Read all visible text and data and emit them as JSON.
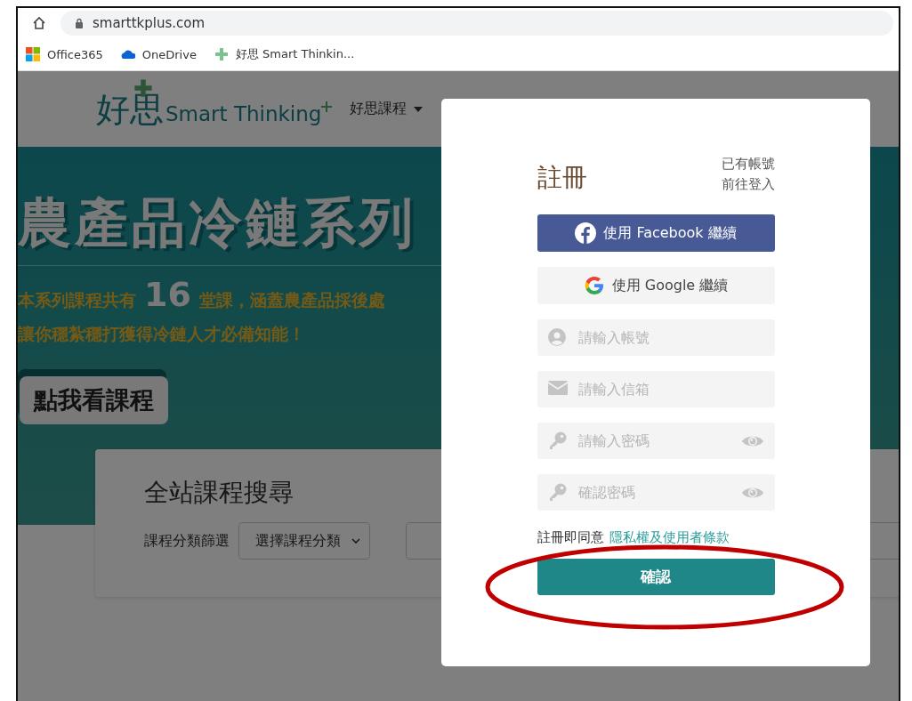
{
  "browser": {
    "url": "smarttkplus.com",
    "bookmarks": [
      {
        "kind": "office",
        "label": "Office365"
      },
      {
        "kind": "cloud",
        "label": "OneDrive"
      },
      {
        "kind": "plus",
        "label": "好思 Smart Thinkin..."
      }
    ]
  },
  "header": {
    "logo_cjk": "好思",
    "logo_text": "Smart Thinking",
    "nav": [
      {
        "label": "好思課程",
        "has_menu": true
      }
    ]
  },
  "banner": {
    "title": "農產品冷鏈系列",
    "line1_before": "本系列課程共有",
    "line1_number": "16",
    "line1_after": "堂課，涵蓋農產品採後處",
    "line2": "讓你穩紮穩打獲得冷鏈人才必備知能！",
    "button": "點我看課程"
  },
  "search": {
    "title": "全站課程搜尋",
    "filter_label": "課程分類篩選",
    "select": "選擇課程分類"
  },
  "modal": {
    "title": "註冊",
    "login_lines": [
      "已有帳號",
      "前往登入"
    ],
    "social": [
      {
        "kind": "facebook",
        "label": "使用 Facebook 繼續"
      },
      {
        "kind": "google",
        "label": "使用 Google 繼續"
      }
    ],
    "fields": [
      {
        "kind": "user",
        "placeholder": "請輸入帳號"
      },
      {
        "kind": "email",
        "placeholder": "請輸入信箱"
      },
      {
        "kind": "password",
        "placeholder": "請輸入密碼"
      },
      {
        "kind": "password",
        "placeholder": "確認密碼"
      }
    ],
    "agree_text": "註冊即同意",
    "agree_link": "隱私權及使用者條款",
    "submit": "確認"
  }
}
